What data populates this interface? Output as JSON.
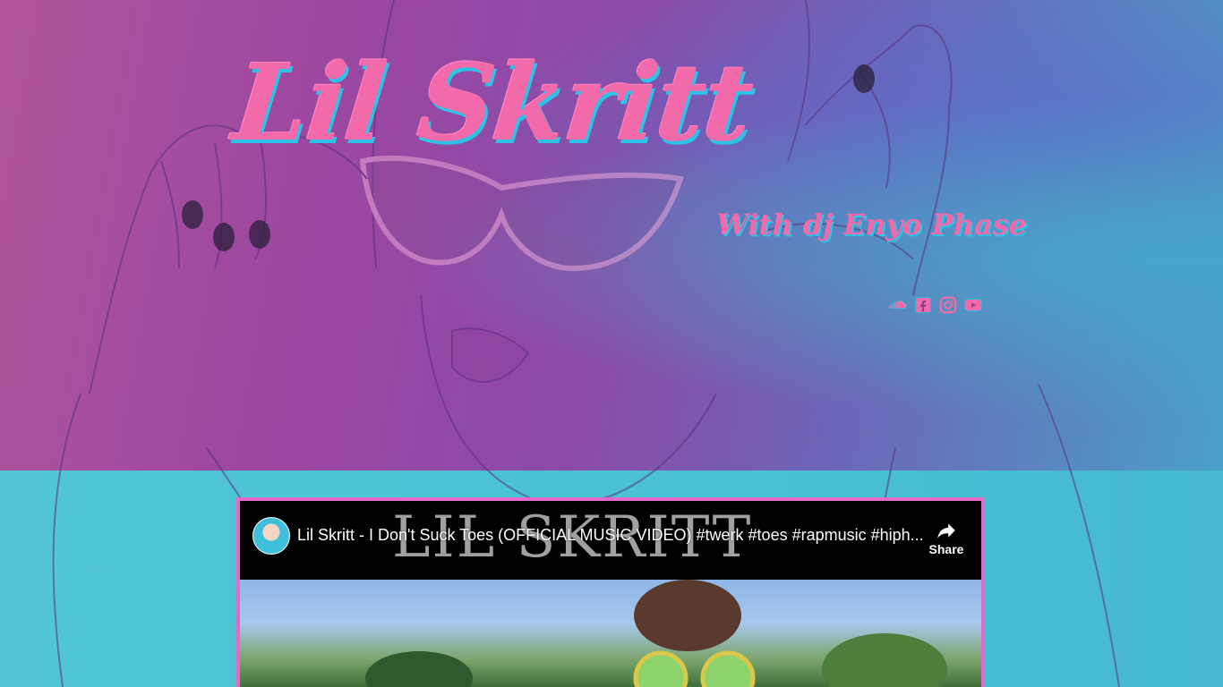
{
  "header": {
    "title": "Lil Skritt",
    "subtitle": "With dj Enyo Phase"
  },
  "social": [
    {
      "name": "soundcloud-icon"
    },
    {
      "name": "facebook-icon"
    },
    {
      "name": "instagram-icon"
    },
    {
      "name": "youtube-icon"
    }
  ],
  "video": {
    "title": "Lil Skritt - I Don't Suck Toes (OFFICIAL MUSIC VIDEO) #twerk #toes #rapmusic #hiph...",
    "banner": "LIL SKRITT",
    "share_label": "Share"
  },
  "colors": {
    "accent_pink": "#f26aa9",
    "accent_cyan": "#2cc3e6",
    "video_border": "#e469c9"
  }
}
